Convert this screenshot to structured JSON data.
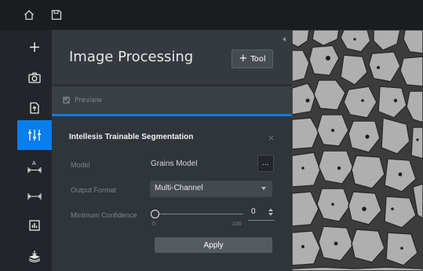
{
  "topbar": {
    "home_icon": "home-icon",
    "save_icon": "save-icon"
  },
  "rail": {
    "items": [
      {
        "icon": "plus-icon"
      },
      {
        "icon": "camera-icon"
      },
      {
        "icon": "import-icon"
      },
      {
        "icon": "sliders-icon",
        "active": true
      },
      {
        "icon": "measure-angle-icon"
      },
      {
        "icon": "measure-distance-icon"
      },
      {
        "icon": "report-icon"
      },
      {
        "icon": "stack-icon"
      }
    ]
  },
  "panel": {
    "title": "Image Processing",
    "tool_button_label": "Tool",
    "preview_label": "Preview"
  },
  "segmentation": {
    "title": "Intellesis Trainable Segmentation",
    "close_glyph": "×",
    "model_label": "Model",
    "model_value": "Grains Model",
    "browse_glyph": "...",
    "output_format_label": "Output Format",
    "output_format_value": "Multi-Channel",
    "confidence_label": "Minimum Confidence",
    "confidence_min": "0",
    "confidence_max": "100",
    "confidence_value": "0",
    "apply_label": "Apply"
  },
  "colors": {
    "accent": "#0b7de9",
    "panel": "#2b2f33",
    "header": "#353a3f"
  }
}
